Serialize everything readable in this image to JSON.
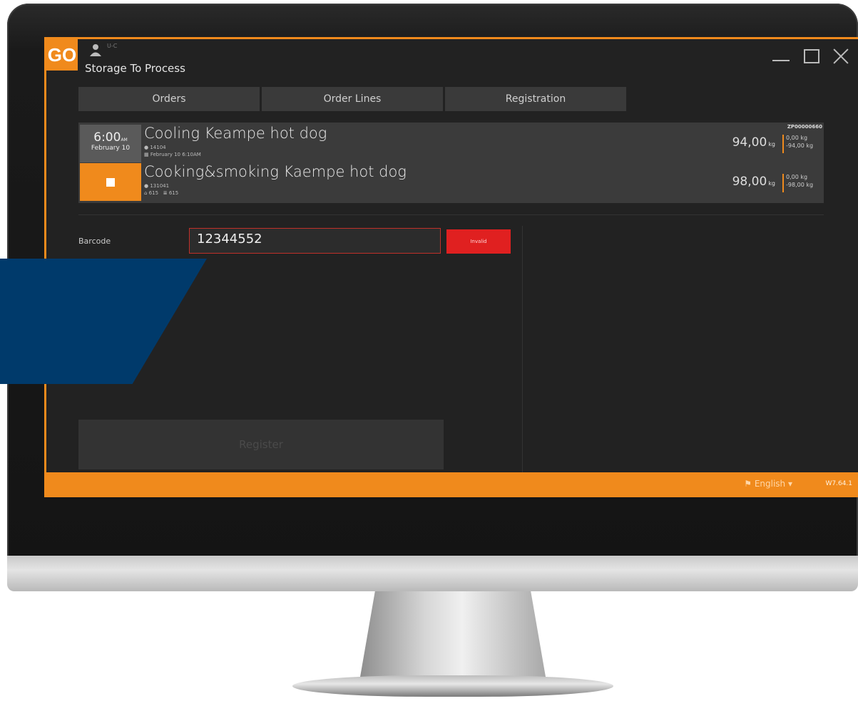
{
  "window": {
    "logo": "GO",
    "user_sub": "U-C",
    "title": "Storage To Process"
  },
  "tabs": [
    {
      "label": "Orders"
    },
    {
      "label": "Order Lines"
    },
    {
      "label": "Registration"
    }
  ],
  "order": {
    "id": "ZP00000660",
    "time": "6:00",
    "time_suffix": "AM",
    "date": "February 10",
    "line1": {
      "name": "Cooling Keampe hot dog",
      "meta_id": "14104",
      "meta_date": "February 10 6:10AM",
      "weight": "94,00",
      "unit": "kg",
      "sub_top": "0,00 kg",
      "sub_bottom": "-94,00 kg"
    },
    "line2": {
      "name": "Cooking&smoking Kaempe hot dog",
      "meta_id": "131041",
      "meta_a": "615",
      "meta_b": "615",
      "weight": "98,00",
      "unit": "kg",
      "sub_top": "0,00 kg",
      "sub_bottom": "-98,00 kg"
    }
  },
  "form": {
    "barcode_label": "Barcode",
    "barcode_value": "12344552",
    "invalid_label": "Invalid",
    "register_label": "Register"
  },
  "status": {
    "language": "English",
    "version": "W7.64.1"
  },
  "colors": {
    "accent": "#f08a1c",
    "error": "#e02020",
    "background": "#222222"
  }
}
